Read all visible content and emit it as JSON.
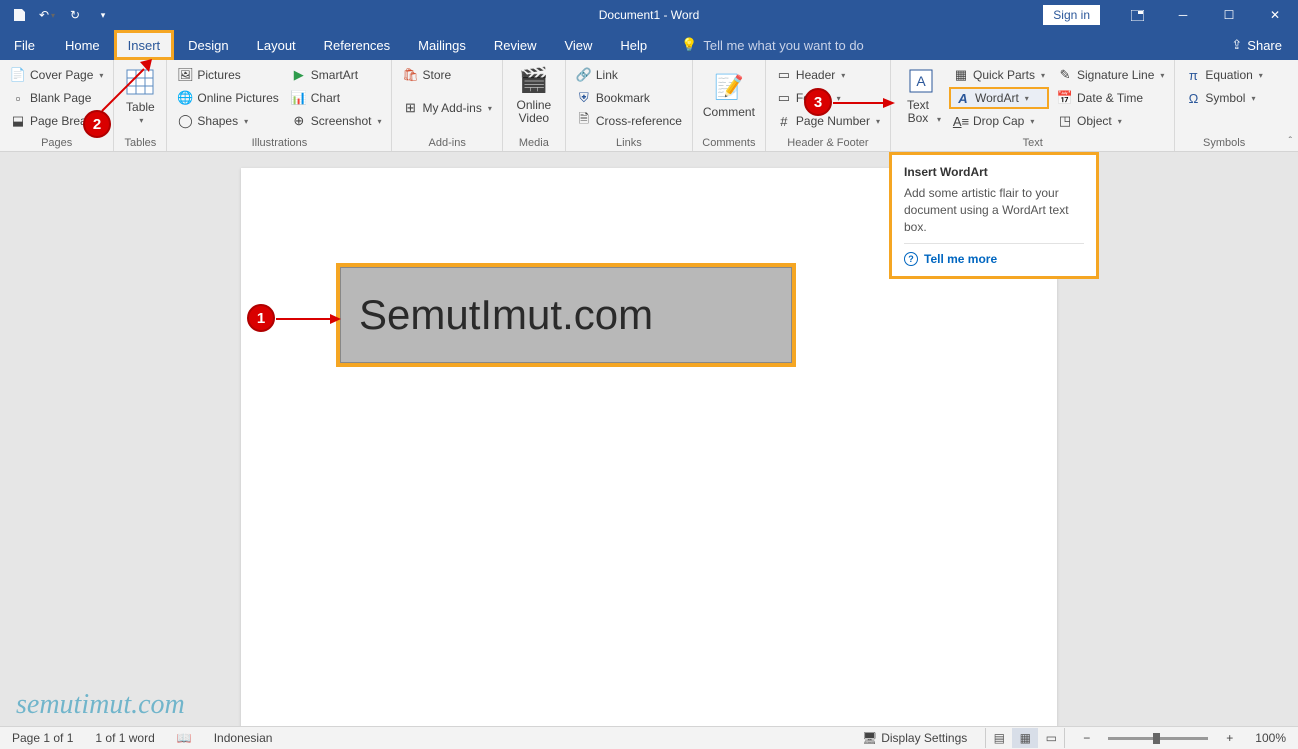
{
  "titlebar": {
    "doc_title": "Document1 - Word",
    "signin": "Sign in"
  },
  "tabs": {
    "file": "File",
    "home": "Home",
    "insert": "Insert",
    "design": "Design",
    "layout": "Layout",
    "references": "References",
    "mailings": "Mailings",
    "review": "Review",
    "view": "View",
    "help": "Help",
    "tellme": "Tell me what you want to do",
    "share": "Share"
  },
  "ribbon": {
    "pages": {
      "label": "Pages",
      "cover_page": "Cover Page",
      "blank_page": "Blank Page",
      "page_break": "Page Break"
    },
    "tables": {
      "label": "Tables",
      "table": "Table"
    },
    "illustrations": {
      "label": "Illustrations",
      "pictures": "Pictures",
      "online_pictures": "Online Pictures",
      "shapes": "Shapes",
      "smartart": "SmartArt",
      "chart": "Chart",
      "screenshot": "Screenshot"
    },
    "addins": {
      "label": "Add-ins",
      "store": "Store",
      "my_addins": "My Add-ins"
    },
    "media": {
      "label": "Media",
      "online_video": "Online Video"
    },
    "links": {
      "label": "Links",
      "link": "Link",
      "bookmark": "Bookmark",
      "cross_reference": "Cross-reference"
    },
    "comments": {
      "label": "Comments",
      "comment": "Comment"
    },
    "header_footer": {
      "label": "Header & Footer",
      "header": "Header",
      "footer": "Footer",
      "page_number": "Page Number"
    },
    "text": {
      "label": "Text",
      "text_box": "Text Box",
      "quick_parts": "Quick Parts",
      "wordart": "WordArt",
      "drop_cap": "Drop Cap",
      "signature_line": "Signature Line",
      "date_time": "Date & Time",
      "object": "Object"
    },
    "symbols": {
      "label": "Symbols",
      "equation": "Equation",
      "symbol": "Symbol"
    }
  },
  "tooltip": {
    "title": "Insert WordArt",
    "desc": "Add some artistic flair to your document using a WordArt text box.",
    "link": "Tell me more"
  },
  "document": {
    "text_content": "SemutImut.com"
  },
  "callouts": {
    "c1": "1",
    "c2": "2",
    "c3": "3"
  },
  "statusbar": {
    "page": "Page 1 of 1",
    "words": "1 of 1 word",
    "language": "Indonesian",
    "display_settings": "Display Settings",
    "zoom": "100%"
  },
  "watermark": "semutimut.com"
}
